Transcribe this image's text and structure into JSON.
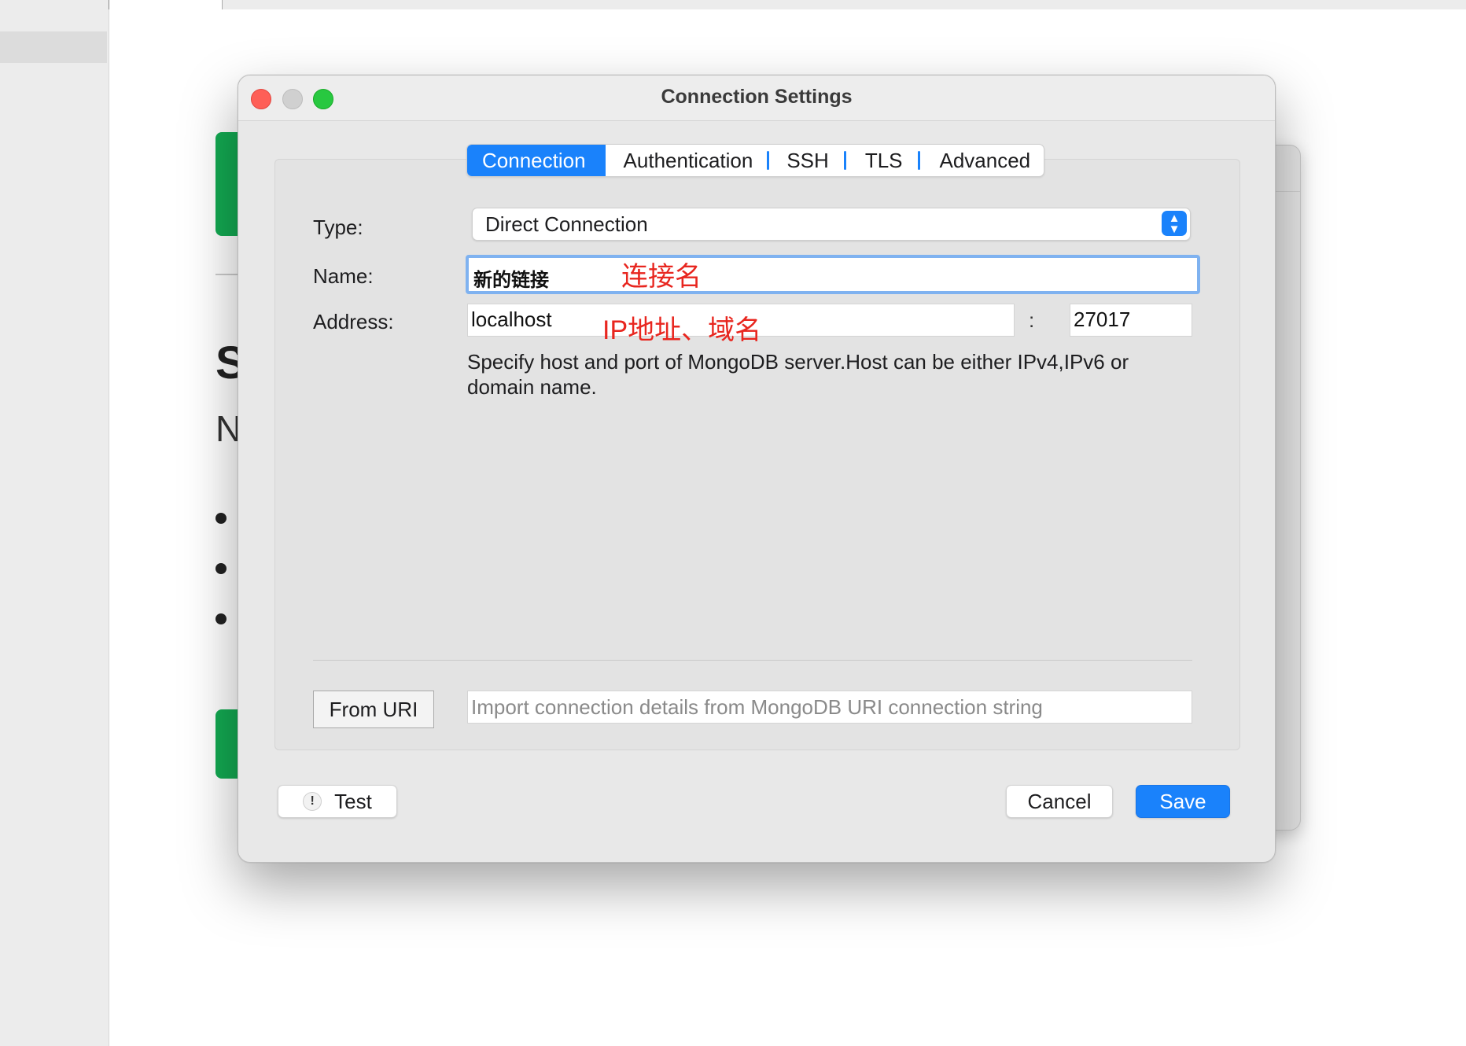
{
  "background": {
    "big_letter": "S",
    "sub_letter": "N"
  },
  "dialog": {
    "title": "Connection Settings",
    "tabs": [
      {
        "label": "Connection",
        "active": true
      },
      {
        "label": "Authentication",
        "active": false
      },
      {
        "label": "SSH",
        "active": false
      },
      {
        "label": "TLS",
        "active": false
      },
      {
        "label": "Advanced",
        "active": false
      }
    ],
    "type_label": "Type:",
    "type_value": "Direct Connection",
    "name_label": "Name:",
    "name_value": "新的链接",
    "name_annotation": "连接名",
    "address_label": "Address:",
    "address_value": "localhost",
    "address_annotation": "IP地址、域名",
    "port_separator": ":",
    "port_value": "27017",
    "help_text": "Specify host and port of MongoDB server.Host can be either IPv4,IPv6 or domain name.",
    "from_uri_button": "From URI",
    "uri_placeholder": "Import connection details from MongoDB URI connection string",
    "test_button": "Test",
    "test_icon_glyph": "!",
    "cancel_button": "Cancel",
    "save_button": "Save",
    "colors": {
      "accent": "#1a82fb",
      "annotation": "#e8261f",
      "close": "#fe5f57",
      "maximize": "#28c840"
    }
  }
}
